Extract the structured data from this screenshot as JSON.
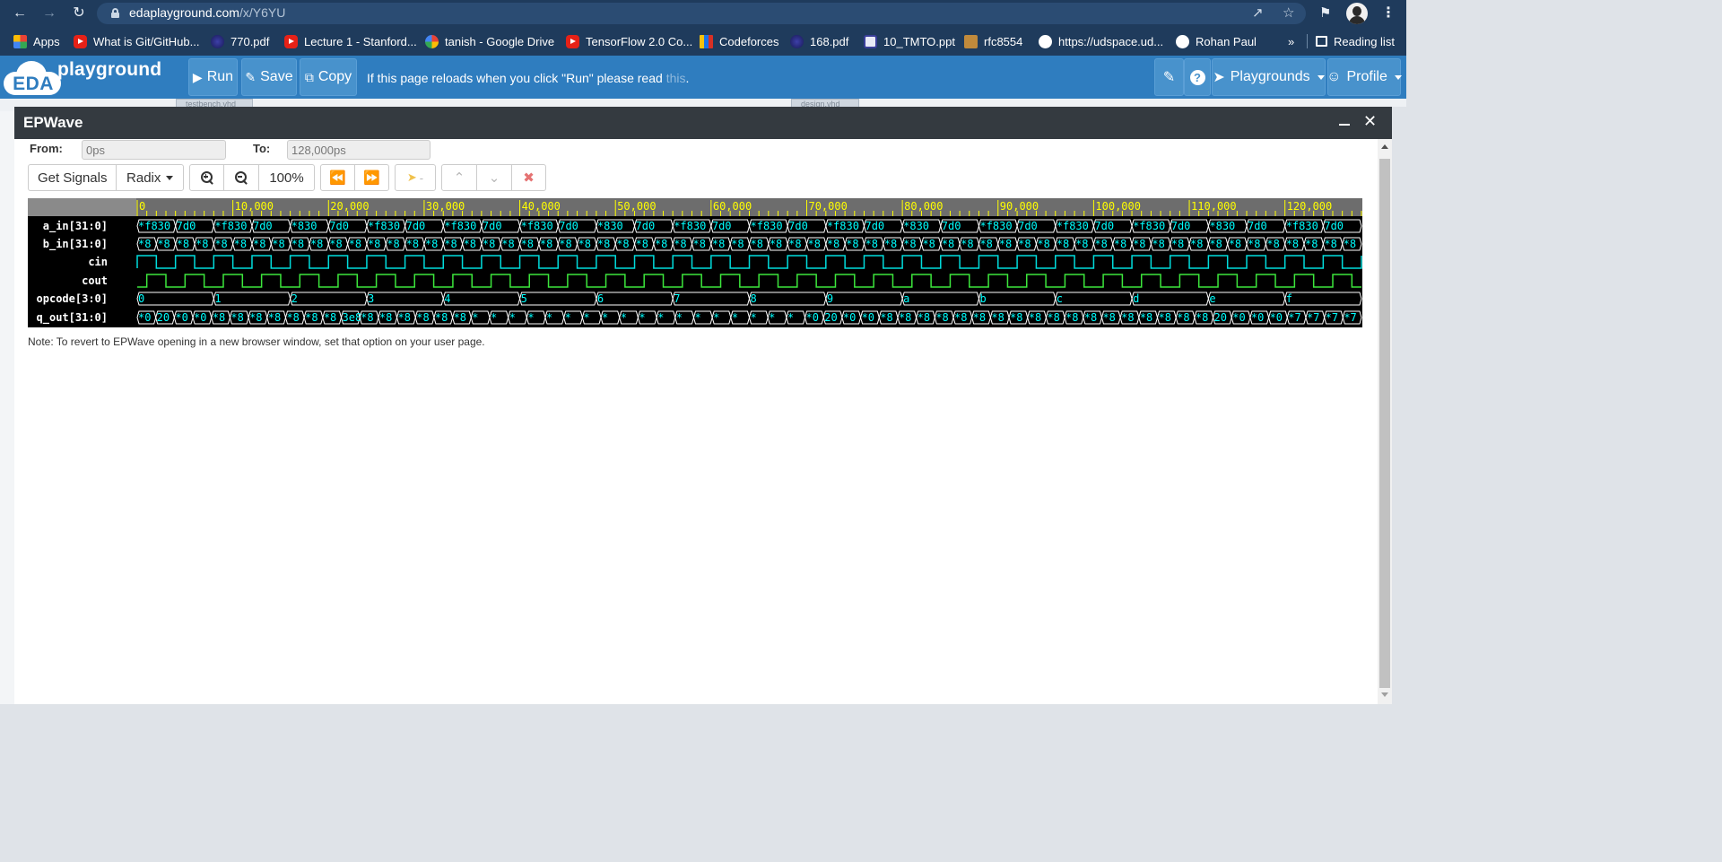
{
  "browser": {
    "url_host": "edaplayground.com",
    "url_path": "/x/Y6YU",
    "bookmarks": [
      {
        "label": "Apps",
        "icon": "apps-icon"
      },
      {
        "label": "What is Git/GitHub...",
        "icon": "youtube-icon"
      },
      {
        "label": "770.pdf",
        "icon": "pdf-icon"
      },
      {
        "label": "Lecture 1 - Stanford...",
        "icon": "youtube-icon"
      },
      {
        "label": "tanish - Google Drive",
        "icon": "google-icon"
      },
      {
        "label": "TensorFlow 2.0 Co...",
        "icon": "youtube-icon"
      },
      {
        "label": "Codeforces",
        "icon": "codeforces-icon"
      },
      {
        "label": "168.pdf",
        "icon": "pdf-icon"
      },
      {
        "label": "10_TMTO.ppt",
        "icon": "ppt-icon"
      },
      {
        "label": "rfc8554",
        "icon": "rfc-icon"
      },
      {
        "label": "https://udspace.ud...",
        "icon": "globe-icon"
      },
      {
        "label": "Rohan Paul",
        "icon": "globe-icon"
      }
    ],
    "overflow_label": "»",
    "reading_list": "Reading list"
  },
  "eda": {
    "logo_badge": "EDA",
    "logo_word": "playground",
    "run": "Run",
    "save": "Save",
    "copy": "Copy",
    "message": "If this page reloads when you click \"Run\" please read ",
    "message_link": "this",
    "message_end": ".",
    "playgrounds": "Playgrounds",
    "profile": "Profile",
    "tab_testbench": "testbench.vhd",
    "tab_design": "design.vhd"
  },
  "epwave": {
    "title": "EPWave",
    "from_label": "From:",
    "from_value": "0ps",
    "to_label": "To:",
    "to_value": "128,000ps",
    "get_signals": "Get Signals",
    "radix": "Radix",
    "zoom_level": "100%",
    "marker_label": "-",
    "note": "Note: To revert to EPWave opening in a new browser window, set that option on your user page.",
    "colors": {
      "panel_bg": "#000000",
      "value_text": "#00ffff",
      "bus_outline": "#ffffff",
      "scale_bg": "#6d6d6d",
      "scale_text": "#ffff00",
      "cin_wave": "#00dcdc",
      "cout_wave": "#3ce63c"
    },
    "timescale": {
      "start": 0,
      "end": 128000,
      "labels": [
        "0",
        "10,000",
        "20,000",
        "30,000",
        "40,000",
        "50,000",
        "60,000",
        "70,000",
        "80,000",
        "90,000",
        "100,000",
        "110,000",
        "120,000"
      ]
    },
    "signals": [
      {
        "name": "a_in[31:0]",
        "type": "bus",
        "values": [
          "*f830",
          "7d0",
          "*f830",
          "7d0",
          "*830",
          "7d0",
          "*f830",
          "7d0",
          "*f830",
          "7d0",
          "*f830",
          "7d0",
          "*830",
          "7d0",
          "*f830",
          "7d0",
          "*f830",
          "7d0",
          "*f830",
          "7d0",
          "*830",
          "7d0",
          "*f830",
          "7d0",
          "*f830",
          "7d0",
          "*f830",
          "7d0",
          "*830",
          "7d0",
          "*f830",
          "7d0"
        ]
      },
      {
        "name": "b_in[31:0]",
        "type": "bus",
        "values": [
          "*8",
          "*8",
          "*8",
          "*8",
          "*8",
          "*8",
          "*8",
          "*8",
          "*8",
          "*8",
          "*8",
          "*8",
          "*8",
          "*8",
          "*8",
          "*8",
          "*8",
          "*8",
          "*8",
          "*8",
          "*8",
          "*8",
          "*8",
          "*8",
          "*8",
          "*8",
          "*8",
          "*8",
          "*8",
          "*8",
          "*8",
          "*8",
          "*8",
          "*8",
          "*8",
          "*8",
          "*8",
          "*8",
          "*8",
          "*8",
          "*8",
          "*8",
          "*8",
          "*8",
          "*8",
          "*8",
          "*8",
          "*8",
          "*8",
          "*8",
          "*8",
          "*8",
          "*8",
          "*8",
          "*8",
          "*8",
          "*8",
          "*8",
          "*8",
          "*8",
          "*8",
          "*8",
          "*8",
          "*8"
        ]
      },
      {
        "name": "cin",
        "type": "bit"
      },
      {
        "name": "cout",
        "type": "bit"
      },
      {
        "name": "opcode[3:0]",
        "type": "bus",
        "values": [
          "0",
          "1",
          "2",
          "3",
          "4",
          "5",
          "6",
          "7",
          "8",
          "9",
          "a",
          "b",
          "c",
          "d",
          "e",
          "f"
        ]
      },
      {
        "name": "q_out[31:0]",
        "type": "bus",
        "values": [
          "*0",
          "20",
          "*0",
          "*0",
          "*8",
          "*8",
          "*8",
          "*8",
          "*8",
          "*8",
          "*8",
          "3e8",
          "*8",
          "*8",
          "*8",
          "*8",
          "*8",
          "*8",
          "*",
          "*",
          "*",
          "*",
          "*",
          "*",
          "*",
          "*",
          "*",
          "*",
          "*",
          "*",
          "*",
          "*",
          "*",
          "*",
          "*",
          "*",
          "*0",
          "20",
          "*0",
          "*0",
          "*8",
          "*8",
          "*8",
          "*8",
          "*8",
          "*8",
          "*8",
          "*8",
          "*8",
          "*8",
          "*8",
          "*8",
          "*8",
          "*8",
          "*8",
          "*8",
          "*8",
          "*8",
          "20",
          "*0",
          "*0",
          "*0",
          "*7",
          "*7",
          "*7",
          "*7"
        ]
      }
    ]
  }
}
